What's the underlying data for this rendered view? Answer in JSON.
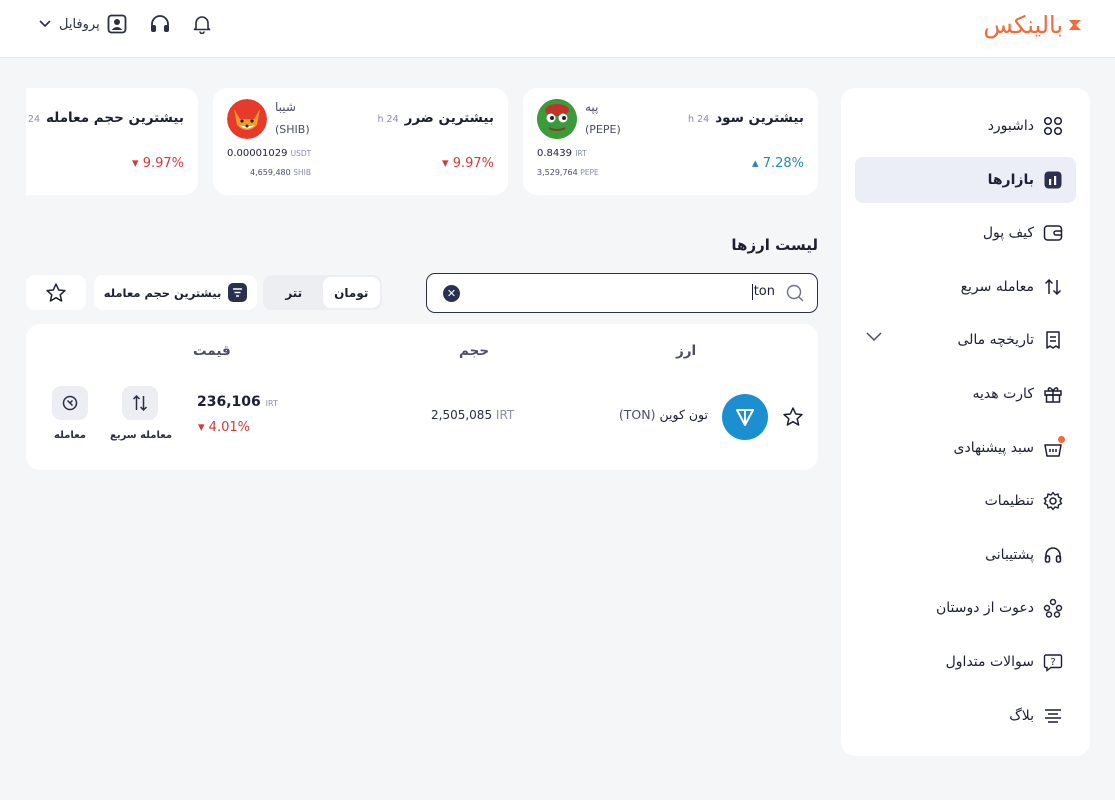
{
  "header": {
    "logo": "بالینکس",
    "profile_label": "پروفایل",
    "icons": [
      "user-icon",
      "headset-icon",
      "bell-icon",
      "chevron-down-icon"
    ]
  },
  "sidebar": {
    "items": [
      {
        "label": "داشبورد",
        "icon": "dashboard-icon"
      },
      {
        "label": "بازارها",
        "icon": "markets-icon",
        "active": true
      },
      {
        "label": "کیف پول",
        "icon": "wallet-icon"
      },
      {
        "label": "معامله سریع",
        "icon": "swap-icon"
      },
      {
        "label": "تاریخچه مالی",
        "icon": "history-icon",
        "expandable": true
      },
      {
        "label": "کارت هدیه",
        "icon": "gift-icon"
      },
      {
        "label": "سبد پیشنهادی",
        "icon": "basket-icon",
        "badge": true
      },
      {
        "label": "تنظیمات",
        "icon": "settings-icon"
      },
      {
        "label": "پشتیبانی",
        "icon": "headset-icon"
      },
      {
        "label": "دعوت از دوستان",
        "icon": "invite-icon"
      },
      {
        "label": "سوالات متداول",
        "icon": "faq-icon"
      },
      {
        "label": "بلاگ",
        "icon": "blog-icon"
      }
    ]
  },
  "cards": [
    {
      "title": "بیشترین سود",
      "period": "24 h",
      "change": "7.28%",
      "direction": "up",
      "coin_name": "پپه",
      "coin_symbol": "(PEPE)",
      "price": "0.8439",
      "price_unit": "IRT",
      "volume": "3,529,764",
      "volume_unit": "PEPE"
    },
    {
      "title": "بیشترین ضرر",
      "period": "24 h",
      "change": "9.97%",
      "direction": "down",
      "coin_name": "شیبا",
      "coin_symbol": "(SHIB)",
      "price": "0.00001029",
      "price_unit": "USDT",
      "volume": "4,659,480",
      "volume_unit": "SHIB"
    },
    {
      "title": "بیشترین حجم معامله",
      "period": "24 h",
      "change": "9.97%",
      "direction": "down"
    }
  ],
  "market": {
    "list_title": "لیست ارزها",
    "search_value": "ton",
    "quote_options": [
      "تومان",
      "تتر"
    ],
    "selected_quote": "تومان",
    "sort_label": "بیشترین حجم معامله",
    "columns": [
      "ارز",
      "حجم",
      "قیمت"
    ],
    "rows": [
      {
        "name": "تون کوین",
        "symbol": "(TON)",
        "volume": "2,505,085",
        "volume_unit": "IRT",
        "price": "236,106",
        "price_unit": "IRT",
        "change": "4.01%",
        "direction": "down",
        "quick_trade_label": "معامله سریع",
        "trade_label": "معامله"
      }
    ]
  },
  "colors": {
    "brand": "#f26b3a",
    "navy": "#2c3050",
    "positive": "#1d8bb8",
    "negative": "#d23a3a",
    "background": "#f5f6f8"
  }
}
